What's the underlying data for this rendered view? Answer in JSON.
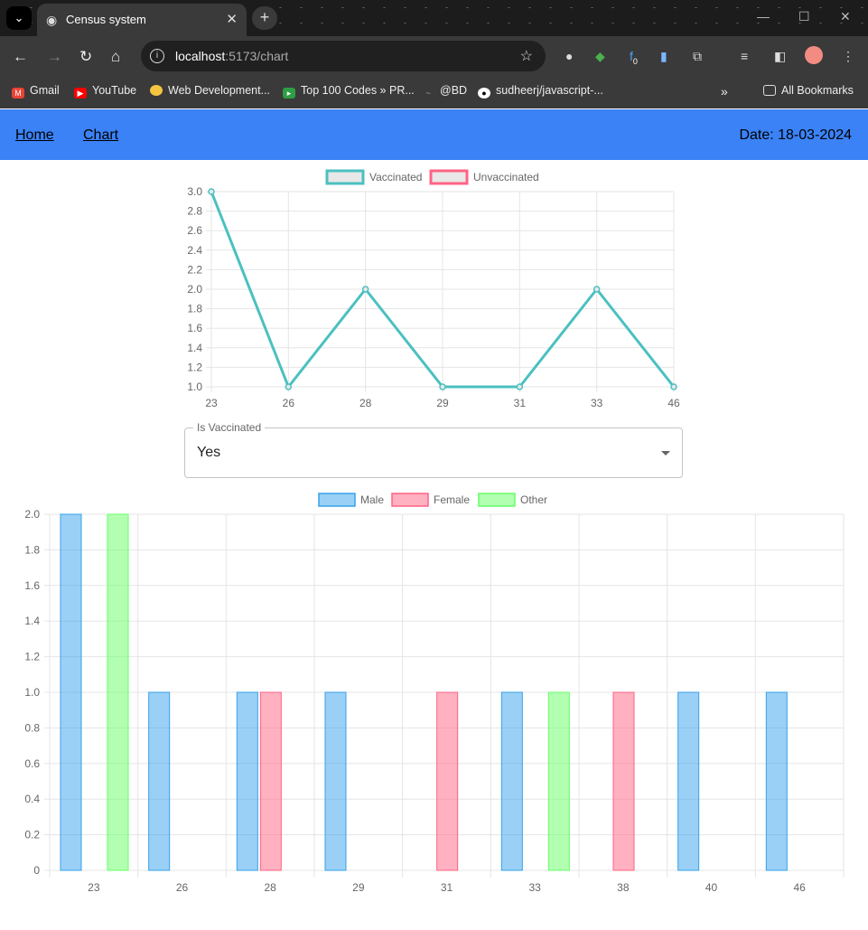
{
  "browser": {
    "tab_title": "Census system",
    "url_host": "localhost",
    "url_path": ":5173/chart",
    "bookmarks": [
      "Gmail",
      "YouTube",
      "Web Development...",
      "Top 100 Codes » PR...",
      "@BD",
      "sudheerj/javascript-..."
    ],
    "all_bookmarks": "All Bookmarks",
    "ext_badge": "0"
  },
  "header": {
    "nav": [
      "Home",
      "Chart"
    ],
    "date": "Date: 18-03-2024"
  },
  "select": {
    "label": "Is Vaccinated",
    "value": "Yes"
  },
  "colors": {
    "appbar": "#3b82f6",
    "teal": "#4bc0c0",
    "red": "#ff6384",
    "blue": "#36a2eb",
    "green": "#66ff66"
  },
  "chart_data": [
    {
      "type": "line",
      "legend": [
        "Vaccinated",
        "Unvaccinated"
      ],
      "legend_position": "top",
      "categories": [
        "23",
        "26",
        "28",
        "29",
        "31",
        "33",
        "46"
      ],
      "series": [
        {
          "name": "Vaccinated",
          "values": [
            3,
            1,
            2,
            1,
            1,
            2,
            1
          ]
        }
      ],
      "ylim": [
        1.0,
        3.0
      ],
      "yticks": [
        "3.0",
        "2.8",
        "2.6",
        "2.4",
        "2.2",
        "2.0",
        "1.8",
        "1.6",
        "1.4",
        "1.2",
        "1.0"
      ],
      "grid": true
    },
    {
      "type": "bar",
      "legend": [
        "Male",
        "Female",
        "Other"
      ],
      "legend_position": "top",
      "categories": [
        "23",
        "26",
        "28",
        "29",
        "31",
        "33",
        "38",
        "40",
        "46"
      ],
      "series": [
        {
          "name": "Male",
          "values": [
            2,
            1,
            1,
            1,
            0,
            1,
            0,
            1,
            1
          ]
        },
        {
          "name": "Female",
          "values": [
            0,
            0,
            1,
            0,
            1,
            0,
            1,
            0,
            0
          ]
        },
        {
          "name": "Other",
          "values": [
            2,
            0,
            0,
            0,
            0,
            1,
            0,
            0,
            0
          ]
        }
      ],
      "ylim": [
        0,
        2.0
      ],
      "yticks": [
        "2.0",
        "1.8",
        "1.6",
        "1.4",
        "1.2",
        "1.0",
        "0.8",
        "0.6",
        "0.4",
        "0.2",
        "0"
      ],
      "grid": true
    }
  ]
}
